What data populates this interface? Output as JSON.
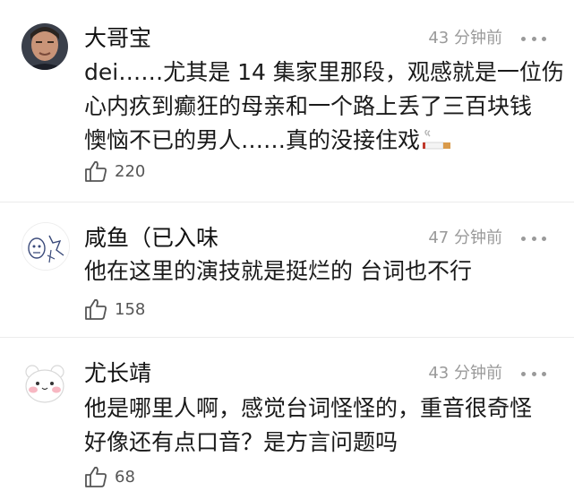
{
  "comments": [
    {
      "username": "大哥宝",
      "time": "43 分钟前",
      "lines": [
        "dei……尤其是 14 集家里那段，观感就是一位伤",
        "心内疚到癫狂的母亲和一个路上丢了三百块钱",
        "懊恼不已的男人……真的没接住戏"
      ],
      "emoji": "cigarette-icon",
      "likes": "220"
    },
    {
      "username": "咸鱼（已入味",
      "time": "47 分钟前",
      "lines": [
        "他在这里的演技就是挺烂的 台词也不行"
      ],
      "likes": "158"
    },
    {
      "username": "尤长靖",
      "time": "43 分钟前",
      "lines": [
        "他是哪里人啊，感觉台词怪怪的，重音很奇怪",
        "好像还有点口音？是方言问题吗"
      ],
      "likes": "68"
    }
  ],
  "colors": {
    "meta": "#9a9a9a",
    "text": "#1a1a1a",
    "divider": "#ececec"
  }
}
